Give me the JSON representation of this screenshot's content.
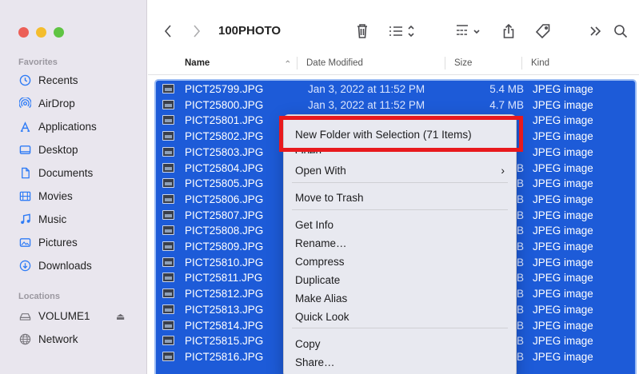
{
  "window": {
    "title": "100PHOTO"
  },
  "sidebar": {
    "favorites_label": "Favorites",
    "favorites": [
      {
        "label": "Recents",
        "icon": "clock-icon"
      },
      {
        "label": "AirDrop",
        "icon": "airdrop-icon"
      },
      {
        "label": "Applications",
        "icon": "applications-icon"
      },
      {
        "label": "Desktop",
        "icon": "desktop-icon"
      },
      {
        "label": "Documents",
        "icon": "document-icon"
      },
      {
        "label": "Movies",
        "icon": "film-icon"
      },
      {
        "label": "Music",
        "icon": "music-note-icon"
      },
      {
        "label": "Pictures",
        "icon": "photo-icon"
      },
      {
        "label": "Downloads",
        "icon": "download-icon"
      }
    ],
    "locations_label": "Locations",
    "locations": [
      {
        "label": "VOLUME1",
        "icon": "drive-icon"
      },
      {
        "label": "Network",
        "icon": "globe-icon"
      }
    ],
    "eject": "⏏"
  },
  "columns": {
    "name": "Name",
    "date": "Date Modified",
    "size": "Size",
    "kind": "Kind"
  },
  "files": [
    {
      "name": "PICT25799.JPG",
      "date": "Jan 3, 2022 at 11:52 PM",
      "size": "5.4 MB",
      "kind": "JPEG image"
    },
    {
      "name": "PICT25800.JPG",
      "date": "Jan 3, 2022 at 11:52 PM",
      "size": "4.7 MB",
      "kind": "JPEG image"
    },
    {
      "name": "PICT25801.JPG",
      "date": "",
      "size": "",
      "kind": "JPEG image"
    },
    {
      "name": "PICT25802.JPG",
      "date": "",
      "size": "",
      "kind": "JPEG image"
    },
    {
      "name": "PICT25803.JPG",
      "date": "",
      "size": "",
      "kind": "JPEG image"
    },
    {
      "name": "PICT25804.JPG",
      "date": "",
      "size": "B",
      "kind": "JPEG image"
    },
    {
      "name": "PICT25805.JPG",
      "date": "",
      "size": "B",
      "kind": "JPEG image"
    },
    {
      "name": "PICT25806.JPG",
      "date": "",
      "size": "B",
      "kind": "JPEG image"
    },
    {
      "name": "PICT25807.JPG",
      "date": "",
      "size": "B",
      "kind": "JPEG image"
    },
    {
      "name": "PICT25808.JPG",
      "date": "",
      "size": "B",
      "kind": "JPEG image"
    },
    {
      "name": "PICT25809.JPG",
      "date": "",
      "size": "B",
      "kind": "JPEG image"
    },
    {
      "name": "PICT25810.JPG",
      "date": "",
      "size": "B",
      "kind": "JPEG image"
    },
    {
      "name": "PICT25811.JPG",
      "date": "",
      "size": "B",
      "kind": "JPEG image"
    },
    {
      "name": "PICT25812.JPG",
      "date": "",
      "size": "B",
      "kind": "JPEG image"
    },
    {
      "name": "PICT25813.JPG",
      "date": "",
      "size": "B",
      "kind": "JPEG image"
    },
    {
      "name": "PICT25814.JPG",
      "date": "",
      "size": "B",
      "kind": "JPEG image"
    },
    {
      "name": "PICT25815.JPG",
      "date": "",
      "size": "B",
      "kind": "JPEG image"
    },
    {
      "name": "PICT25816.JPG",
      "date": "",
      "size": "B",
      "kind": "JPEG image"
    }
  ],
  "context_menu": {
    "new_folder": "New Folder with Selection (71 Items)",
    "open": "Open",
    "open_with": "Open With",
    "open_with_arrow": "›",
    "move_to_trash": "Move to Trash",
    "get_info": "Get Info",
    "rename": "Rename…",
    "compress": "Compress",
    "duplicate": "Duplicate",
    "make_alias": "Make Alias",
    "quick_look": "Quick Look",
    "copy": "Copy",
    "share": "Share…"
  },
  "colors": {
    "selection": "#1d5bd8",
    "highlight_box": "#e8191d"
  }
}
